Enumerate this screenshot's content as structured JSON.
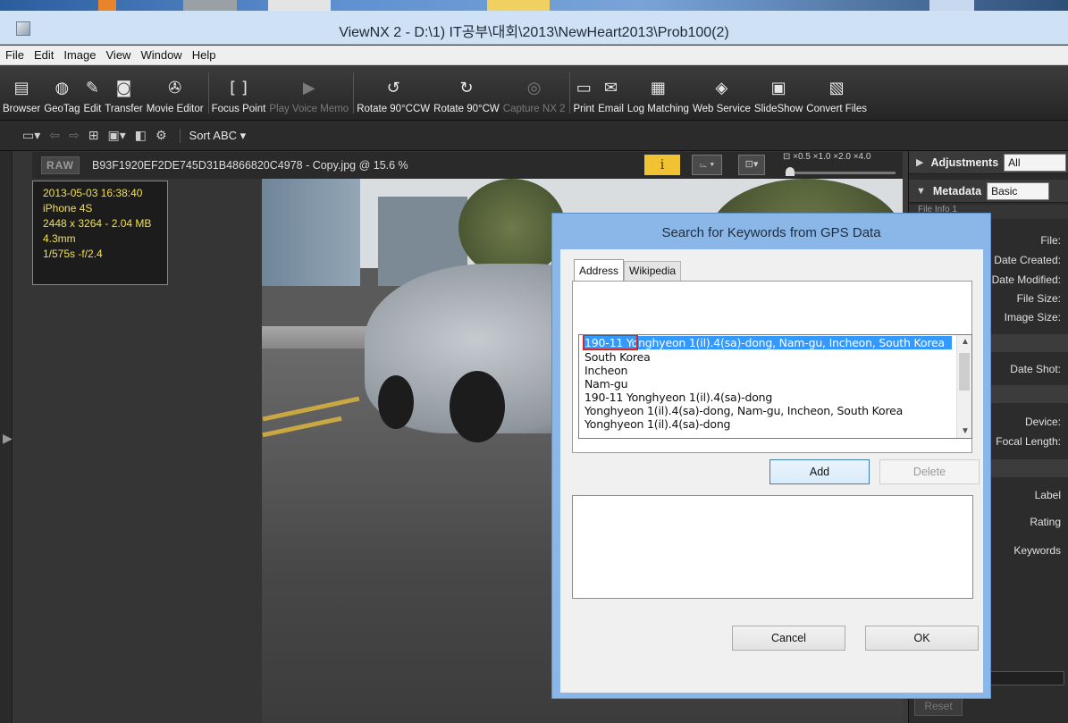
{
  "window": {
    "title": "ViewNX 2 - D:\\1) IT공부\\대회\\2013\\NewHeart2013\\Prob100(2)"
  },
  "menu": [
    "File",
    "Edit",
    "Image",
    "View",
    "Window",
    "Help"
  ],
  "toolbar": [
    {
      "label": "Browser",
      "icon": "browser-icon",
      "glyph": "▤",
      "enabled": true
    },
    {
      "label": "GeoTag",
      "icon": "globe-icon",
      "glyph": "◍",
      "enabled": true
    },
    {
      "label": "Edit",
      "icon": "edit-icon",
      "glyph": "✎",
      "enabled": true
    },
    {
      "label": "Transfer",
      "icon": "camera-icon",
      "glyph": "◙",
      "enabled": true
    },
    {
      "label": "Movie Editor",
      "icon": "film-reel-icon",
      "glyph": "✇",
      "enabled": true
    },
    {
      "label": "Focus Point",
      "icon": "focus-point-icon",
      "glyph": "[ ]",
      "enabled": true
    },
    {
      "label": "Play Voice Memo",
      "icon": "play-icon",
      "glyph": "▶",
      "enabled": false
    },
    {
      "label": "Rotate 90°CCW",
      "icon": "rotate-ccw-icon",
      "glyph": "↺",
      "enabled": true
    },
    {
      "label": "Rotate 90°CW",
      "icon": "rotate-cw-icon",
      "glyph": "↻",
      "enabled": true
    },
    {
      "label": "Capture NX 2",
      "icon": "capture-nx-icon",
      "glyph": "◎",
      "enabled": false
    },
    {
      "label": "Print",
      "icon": "printer-icon",
      "glyph": "▭",
      "enabled": true
    },
    {
      "label": "Email",
      "icon": "email-icon",
      "glyph": "✉",
      "enabled": true
    },
    {
      "label": "Log Matching",
      "icon": "log-matching-icon",
      "glyph": "▦",
      "enabled": true
    },
    {
      "label": "Web Service",
      "icon": "web-service-icon",
      "glyph": "◈",
      "enabled": true
    },
    {
      "label": "SlideShow",
      "icon": "slideshow-icon",
      "glyph": "▣",
      "enabled": true
    },
    {
      "label": "Convert Files",
      "icon": "convert-files-icon",
      "glyph": "▧",
      "enabled": true
    }
  ],
  "toolbar2": {
    "sort_label": "Sort ABC"
  },
  "viewer": {
    "raw_badge": "RAW",
    "filename": "B93F1920EF2DE745D31B4866820C4978 - Copy.jpg @ 15.6 %",
    "info_glyph": "i",
    "zoom_scale": "⊡ ×0.5  ×1.0  ×2.0  ×4.0"
  },
  "photo_info": [
    "2013-05-03 16:38:40",
    "iPhone 4S",
    "2448 x 3264 - 2.04 MB",
    "4.3mm",
    "1/575s -f/2.4"
  ],
  "right_panel": {
    "adjustments_title": "Adjustments",
    "adjustments_value": "All",
    "metadata_title": "Metadata",
    "metadata_value": "Basic",
    "file_info_label": "File Info 1",
    "labels_a": [
      "File:",
      "Date Created:",
      "Date Modified:",
      "File Size:",
      "Image Size:"
    ],
    "date_shot": "Date Shot:",
    "device_labels": [
      "Device:",
      "Focal Length:"
    ],
    "rating_labels": [
      "Label",
      "Rating",
      "Keywords"
    ],
    "scroll_left": "<",
    "reset": "Reset"
  },
  "dialog": {
    "title": "Search for Keywords from GPS Data",
    "tabs": [
      "Address",
      "Wikipedia"
    ],
    "active_tab": "Address",
    "keywords": [
      "190-11 Yonghyeon 1(il).4(sa)-dong, Nam-gu, Incheon, South Korea",
      "South Korea",
      "Incheon",
      "Nam-gu",
      "190-11 Yonghyeon 1(il).4(sa)-dong",
      "Yonghyeon 1(il).4(sa)-dong, Nam-gu, Incheon, South Korea",
      "Yonghyeon 1(il).4(sa)-dong"
    ],
    "add_label": "Add",
    "delete_label": "Delete",
    "cancel_label": "Cancel",
    "ok_label": "OK"
  }
}
